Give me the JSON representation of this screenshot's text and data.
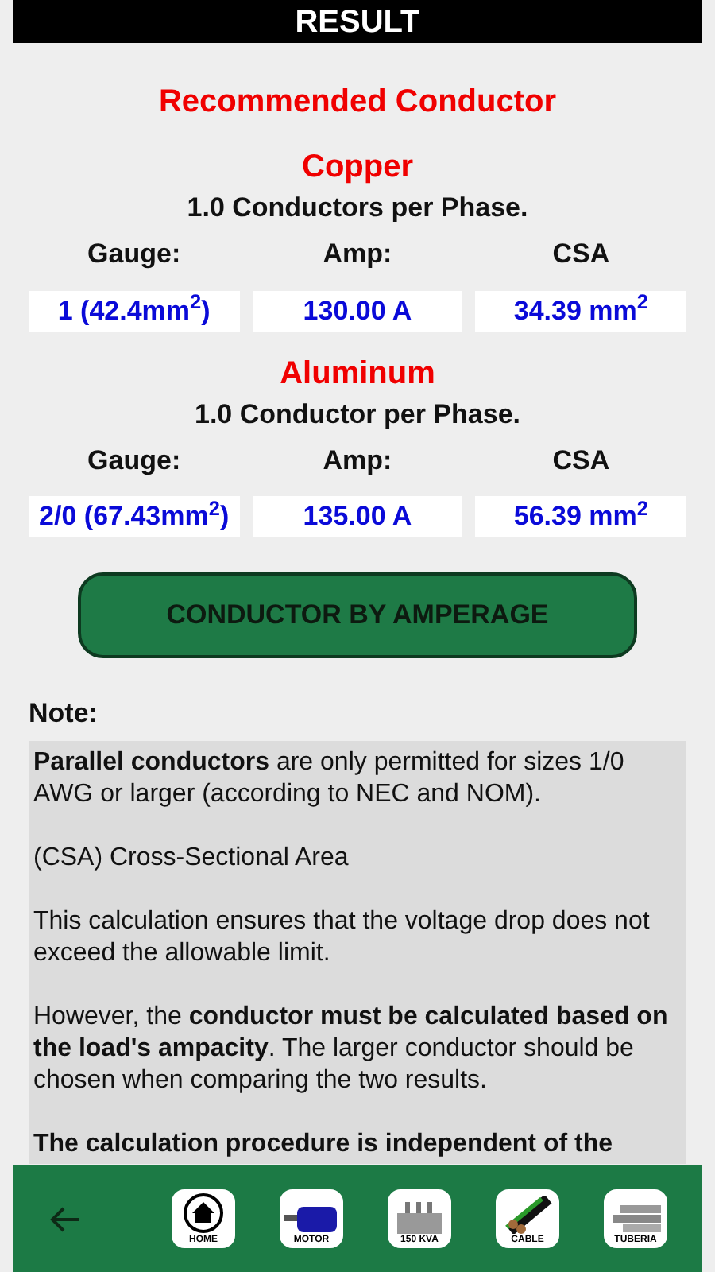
{
  "header": {
    "title": "RESULT"
  },
  "heading": "Recommended Conductor",
  "materials": [
    {
      "name": "Copper",
      "per_phase": "1.0 Conductors per Phase.",
      "columns": [
        "Gauge:",
        "Amp:",
        "CSA"
      ],
      "values": [
        "1 (42.4mm$^{2}$)",
        "130.00 A",
        "34.39 mm$^{2}$"
      ]
    },
    {
      "name": "Aluminum",
      "per_phase": "1.0 Conductor per Phase.",
      "columns": [
        "Gauge:",
        "Amp:",
        "CSA"
      ],
      "values": [
        "2/0 (67.43mm$^{2}$)",
        "135.00 A",
        "56.39 mm$^{2}$"
      ]
    }
  ],
  "action_button": "CONDUCTOR BY AMPERAGE",
  "note": {
    "title": "Note:",
    "paragraphs": [
      "**Parallel conductors** are only permitted for sizes 1/0 AWG or larger (according to NEC and NOM).",
      "(CSA) Cross-Sectional Area",
      "This calculation ensures that the voltage drop does not exceed the allowable limit.",
      "However, the **conductor must be calculated based on the load's ampacity**. The larger conductor should be chosen when comparing the two results.",
      "**The calculation procedure is independent of the**"
    ]
  },
  "nav": [
    {
      "kind": "home",
      "label": "HOME"
    },
    {
      "kind": "motor",
      "label": "MOTOR"
    },
    {
      "kind": "transformer",
      "label": "150 KVA"
    },
    {
      "kind": "cable",
      "label": "CABLE"
    },
    {
      "kind": "pipe",
      "label": "TUBERIA"
    }
  ]
}
